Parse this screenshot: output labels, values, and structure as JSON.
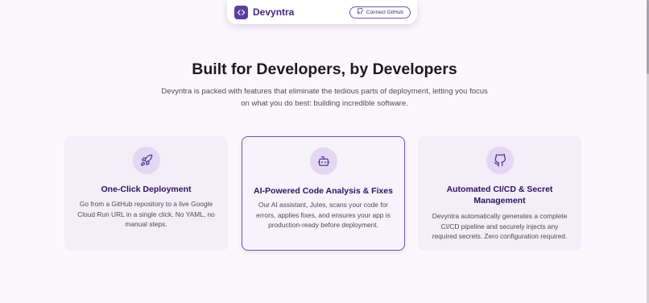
{
  "navbar": {
    "brand_name": "Devyntra",
    "connect_label": "Connect GitHub"
  },
  "section": {
    "title": "Built for Developers, by Developers",
    "subtitle": "Devyntra is packed with features that eliminate the tedious parts of deployment, letting you focus on what you do best: building incredible software."
  },
  "features": [
    {
      "icon": "rocket-icon",
      "title": "One-Click Deployment",
      "description": "Go from a GitHub repository to a live Google Cloud Run URL in a single click. No YAML, no manual steps."
    },
    {
      "icon": "robot-icon",
      "title": "AI-Powered Code Analysis & Fixes",
      "description": "Our AI assistant, Jules, scans your code for errors, applies fixes, and ensures your app is production-ready before deployment."
    },
    {
      "icon": "github-icon",
      "title": "Automated CI/CD & Secret Management",
      "description": "Devyntra automatically generates a complete CI/CD pipeline and securely injects any required secrets. Zero configuration required."
    }
  ],
  "colors": {
    "accent": "#5b3fa0",
    "card_bg": "#f3eef7",
    "page_bg": "#fbf8fd"
  }
}
